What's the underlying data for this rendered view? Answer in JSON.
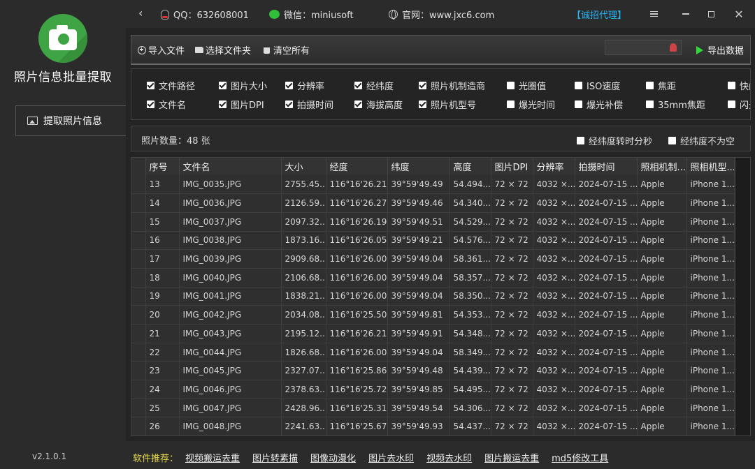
{
  "app": {
    "title": "照片信息批量提取",
    "version": "v2.1.0.1",
    "nav_item": "提取照片信息"
  },
  "topbar": {
    "qq": "QQ：632608001",
    "wechat": "微信：miniusoft",
    "website": "官网：www.jxc6.com",
    "recruit": "【诚招代理】"
  },
  "toolbar": {
    "import_file": "导入文件",
    "select_folder": "选择文件夹",
    "clear_all": "清空所有",
    "export": "导出数据",
    "search_placeholder": ""
  },
  "fields": [
    {
      "label": "文件路径",
      "checked": true
    },
    {
      "label": "图片大小",
      "checked": true
    },
    {
      "label": "分辨率",
      "checked": true
    },
    {
      "label": "经纬度",
      "checked": true
    },
    {
      "label": "照片机制造商",
      "checked": true
    },
    {
      "label": "光圈值",
      "checked": false
    },
    {
      "label": "ISO速度",
      "checked": false
    },
    {
      "label": "焦距",
      "checked": false
    },
    {
      "label": "快门",
      "checked": false
    },
    {
      "label": "文件名",
      "checked": true
    },
    {
      "label": "图片DPI",
      "checked": true
    },
    {
      "label": "拍摄时间",
      "checked": true
    },
    {
      "label": "海拔高度",
      "checked": true
    },
    {
      "label": "照片机型号",
      "checked": true
    },
    {
      "label": "爆光时间",
      "checked": false
    },
    {
      "label": "爆光补偿",
      "checked": false
    },
    {
      "label": "35mm焦距",
      "checked": false
    },
    {
      "label": "闪光",
      "checked": false
    }
  ],
  "count": {
    "text": "照片数量：48 张",
    "option_dms": "经纬度转时分秒",
    "option_dms_checked": false,
    "option_notnull": "经纬度不为空",
    "option_notnull_checked": false
  },
  "table": {
    "columns": [
      "",
      "序号",
      "文件名",
      "大小",
      "经度",
      "纬度",
      "高度",
      "图片DPI",
      "分辨率",
      "拍摄时间",
      "照相机制...",
      "照相机型..."
    ],
    "rows": [
      [
        "13",
        "IMG_0035.JPG",
        "2755.45...",
        "116°16'26.21",
        "39°59'49.49",
        "54.494...",
        "72 × 72",
        "4032 ×...",
        "2024-07-15 ...",
        "Apple",
        "iPhone 1..."
      ],
      [
        "14",
        "IMG_0036.JPG",
        "2126.59...",
        "116°16'26.27",
        "39°59'49.46",
        "54.340...",
        "72 × 72",
        "4032 ×...",
        "2024-07-15 ...",
        "Apple",
        "iPhone 1..."
      ],
      [
        "15",
        "IMG_0037.JPG",
        "2097.32...",
        "116°16'26.19",
        "39°59'49.51",
        "54.529...",
        "72 × 72",
        "4032 ×...",
        "2024-07-15 ...",
        "Apple",
        "iPhone 1..."
      ],
      [
        "16",
        "IMG_0038.JPG",
        "1873.16...",
        "116°16'26.05",
        "39°59'49.21",
        "54.576...",
        "72 × 72",
        "4032 ×...",
        "2024-07-15 ...",
        "Apple",
        "iPhone 1..."
      ],
      [
        "17",
        "IMG_0039.JPG",
        "2909.68...",
        "116°16'26.00",
        "39°59'49.04",
        "58.361...",
        "72 × 72",
        "4032 ×...",
        "2024-07-15 ...",
        "Apple",
        "iPhone 1..."
      ],
      [
        "18",
        "IMG_0040.JPG",
        "2106.68...",
        "116°16'26.00",
        "39°59'49.04",
        "58.357...",
        "72 × 72",
        "4032 ×...",
        "2024-07-15 ...",
        "Apple",
        "iPhone 1..."
      ],
      [
        "19",
        "IMG_0041.JPG",
        "1838.21...",
        "116°16'26.00",
        "39°59'49.04",
        "58.350...",
        "72 × 72",
        "4032 ×...",
        "2024-07-15 ...",
        "Apple",
        "iPhone 1..."
      ],
      [
        "20",
        "IMG_0042.JPG",
        "2034.08...",
        "116°16'25.50",
        "39°59'49.81",
        "54.353...",
        "72 × 72",
        "4032 ×...",
        "2024-07-15 ...",
        "Apple",
        "iPhone 1..."
      ],
      [
        "21",
        "IMG_0043.JPG",
        "2195.12...",
        "116°16'26.21",
        "39°59'49.91",
        "54.348...",
        "72 × 72",
        "4032 ×...",
        "2024-07-15 ...",
        "Apple",
        "iPhone 1..."
      ],
      [
        "22",
        "IMG_0044.JPG",
        "1826.68...",
        "116°16'26.00",
        "39°59'49.04",
        "58.349...",
        "72 × 72",
        "4032 ×...",
        "2024-07-15 ...",
        "Apple",
        "iPhone 1..."
      ],
      [
        "23",
        "IMG_0045.JPG",
        "2327.07...",
        "116°16'25.86",
        "39°59'49.48",
        "54.439...",
        "72 × 72",
        "4032 ×...",
        "2024-07-15 ...",
        "Apple",
        "iPhone 1..."
      ],
      [
        "24",
        "IMG_0046.JPG",
        "2378.63...",
        "116°16'25.72",
        "39°59'49.85",
        "54.495...",
        "72 × 72",
        "4032 ×...",
        "2024-07-15 ...",
        "Apple",
        "iPhone 1..."
      ],
      [
        "25",
        "IMG_0047.JPG",
        "2428.96...",
        "116°16'25.31",
        "39°59'49.54",
        "54.306...",
        "72 × 72",
        "4032 ×...",
        "2024-07-15 ...",
        "Apple",
        "iPhone 1..."
      ],
      [
        "26",
        "IMG_0048.JPG",
        "2241.63...",
        "116°16'25.67",
        "39°59'49.93",
        "54.437...",
        "72 × 72",
        "4032 ×...",
        "2024-07-15 ...",
        "Apple",
        "iPhone 1..."
      ]
    ]
  },
  "recommend": {
    "label": "软件推荐：",
    "links": [
      "视频搬运去重",
      "图片转素描",
      "图像动漫化",
      "图片去水印",
      "视频去水印",
      "图片搬运去重",
      "md5修改工具"
    ]
  },
  "colors": {
    "accent_green": "#31d83a",
    "recruit_blue": "#29b6f6",
    "recommend_label": "#e6d84a",
    "logo_green": "#3fa544"
  },
  "icons": [
    "back-icon",
    "qq-icon",
    "wechat-icon",
    "globe-icon",
    "menu-icon",
    "minimize-icon",
    "maximize-icon",
    "close-icon",
    "camera-logo-icon",
    "picture-icon",
    "plus-circle-icon",
    "folder-icon",
    "trash-icon",
    "play-icon",
    "person-icon"
  ]
}
